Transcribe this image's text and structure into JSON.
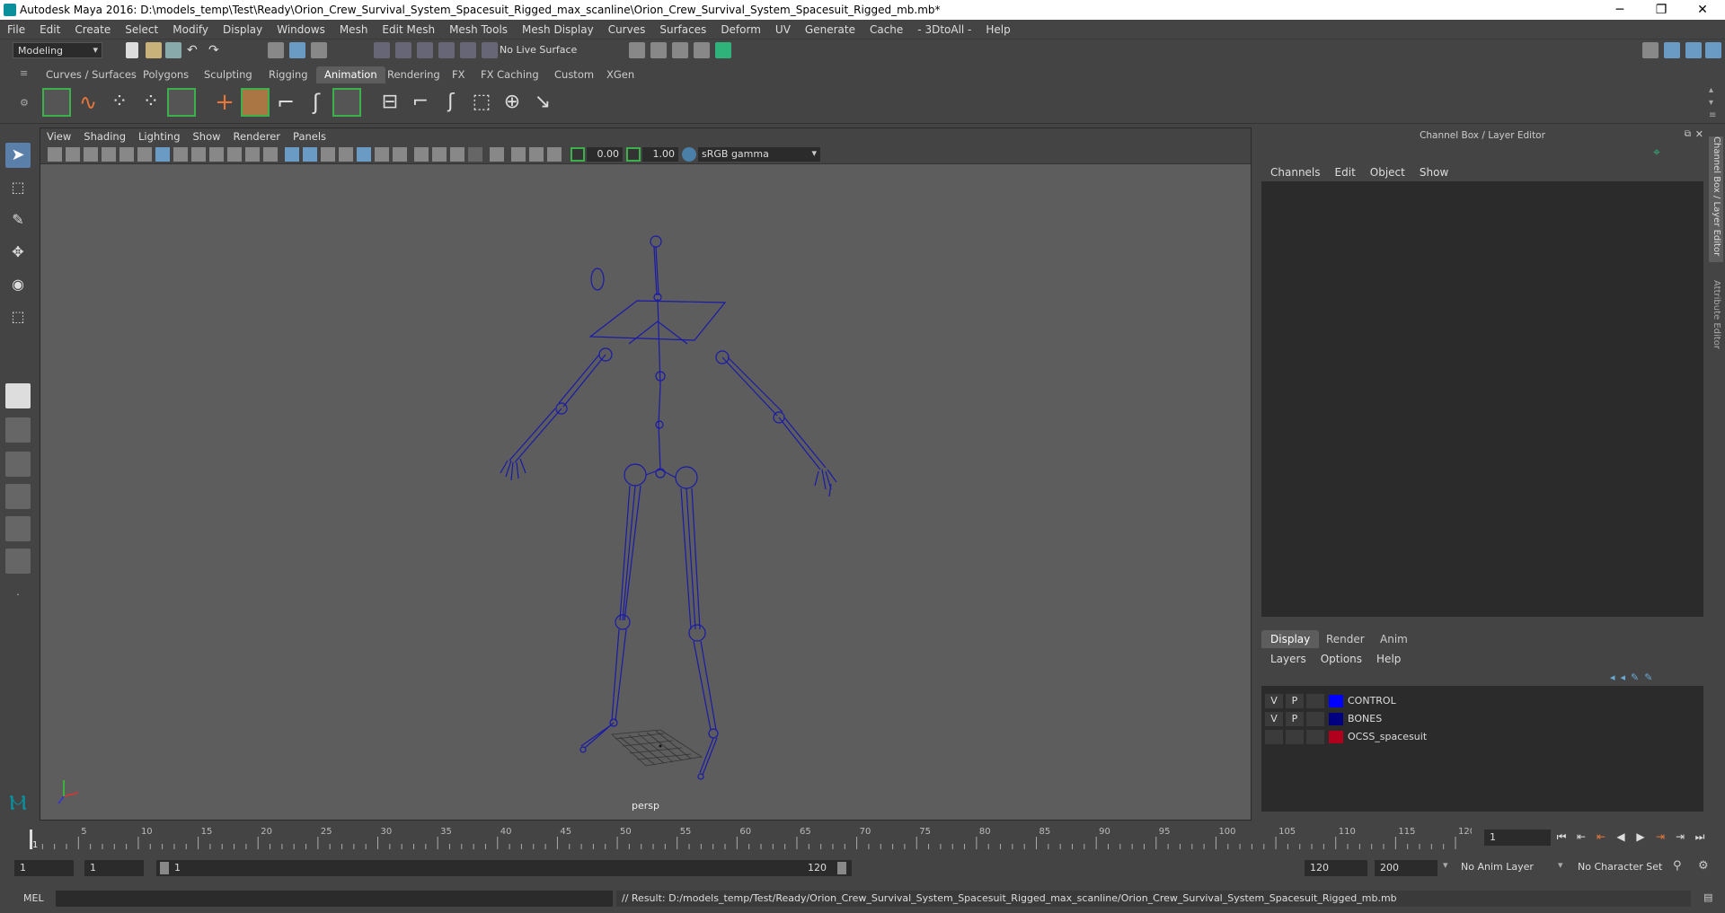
{
  "titlebar": {
    "title": "Autodesk Maya 2016: D:\\models_temp\\Test\\Ready\\Orion_Crew_Survival_System_Spacesuit_Rigged_max_scanline\\Orion_Crew_Survival_System_Spacesuit_Rigged_mb.mb*",
    "minimize": "─",
    "restore": "❐",
    "close": "✕"
  },
  "menu": [
    "File",
    "Edit",
    "Create",
    "Select",
    "Modify",
    "Display",
    "Windows",
    "Mesh",
    "Edit Mesh",
    "Mesh Tools",
    "Mesh Display",
    "Curves",
    "Surfaces",
    "Deform",
    "UV",
    "Generate",
    "Cache",
    "- 3DtoAll -",
    "Help"
  ],
  "status": {
    "mode": "Modeling",
    "live_surface": "No Live Surface"
  },
  "shelf_tabs": [
    {
      "label": "Curves / Surfaces"
    },
    {
      "label": "Polygons"
    },
    {
      "label": "Sculpting"
    },
    {
      "label": "Rigging"
    },
    {
      "label": "Animation",
      "active": true
    },
    {
      "label": "Rendering"
    },
    {
      "label": "FX"
    },
    {
      "label": "FX Caching"
    },
    {
      "label": "Custom"
    },
    {
      "label": "XGen"
    }
  ],
  "viewport": {
    "menu": [
      "View",
      "Shading",
      "Lighting",
      "Show",
      "Renderer",
      "Panels"
    ],
    "exposure": "0.00",
    "gamma": "1.00",
    "color_space": "sRGB gamma",
    "camera_label": "persp",
    "wire_color": "#1a1aa8"
  },
  "right_panel": {
    "title": "Channel Box / Layer Editor",
    "menu": [
      "Channels",
      "Edit",
      "Object",
      "Show"
    ],
    "tabs": [
      {
        "label": "Display",
        "active": true
      },
      {
        "label": "Render"
      },
      {
        "label": "Anim"
      }
    ],
    "layer_menu": [
      "Layers",
      "Options",
      "Help"
    ],
    "layers": [
      {
        "v": "V",
        "p": "P",
        "color": "#0000ff",
        "name": "CONTROL"
      },
      {
        "v": "V",
        "p": "P",
        "color": "#000080",
        "name": "BONES"
      },
      {
        "v": "",
        "p": "",
        "color": "#b0001e",
        "name": "OCSS_spacesuit"
      }
    ],
    "side_tabs": [
      "Channel Box / Layer Editor",
      "Attribute Editor"
    ]
  },
  "timeline": {
    "ticks": [
      "5",
      "10",
      "15",
      "20",
      "25",
      "30",
      "35",
      "40",
      "45",
      "50",
      "55",
      "60",
      "65",
      "70",
      "75",
      "80",
      "85",
      "90",
      "95",
      "100",
      "105",
      "110",
      "115",
      "120"
    ],
    "start_label": "1",
    "current_frame": "1"
  },
  "range": {
    "start": "1",
    "playback_start": "1",
    "slider_start": "1",
    "slider_end": "120",
    "playback_end": "120",
    "end": "200",
    "anim_layer": "No Anim Layer",
    "character_set": "No Character Set"
  },
  "cmdline": {
    "label": "MEL",
    "result": "// Result: D:/models_temp/Test/Ready/Orion_Crew_Survival_System_Spacesuit_Rigged_max_scanline/Orion_Crew_Survival_System_Spacesuit_Rigged_mb.mb"
  }
}
